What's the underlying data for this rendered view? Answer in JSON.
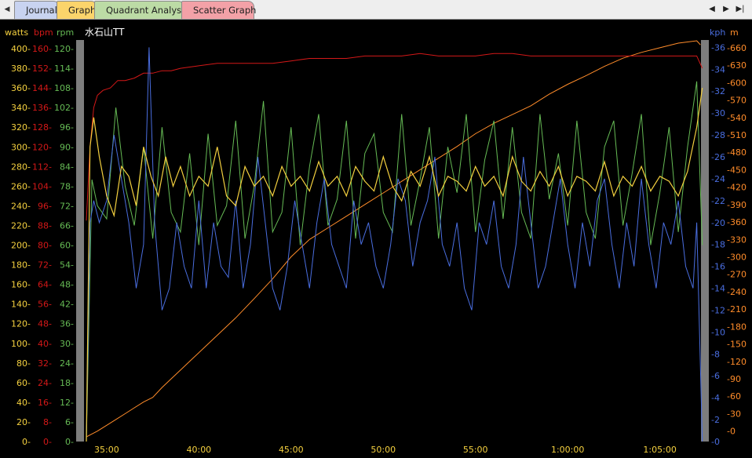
{
  "tabs": [
    {
      "label": "Journal",
      "color": "#c8d3f0"
    },
    {
      "label": "Graph",
      "color": "#fbd46b"
    },
    {
      "label": "Quadrant Analysis",
      "color": "#bcdba5"
    },
    {
      "label": "Scatter Graph",
      "color": "#f3a1a7"
    }
  ],
  "nav": {
    "left": "◀",
    "prev": "◀",
    "play": "▶",
    "next": "▶|"
  },
  "chart_data": {
    "type": "line",
    "title": "水石山TT",
    "colors": {
      "watts": "#f4d03f",
      "bpm": "#d41818",
      "rpm": "#66bb55",
      "kph": "#4a6ee0",
      "m": "#ff8c2a"
    },
    "axes": {
      "watts": {
        "label": "watts",
        "ticks": [
          0,
          20,
          40,
          60,
          80,
          100,
          120,
          140,
          160,
          180,
          200,
          220,
          240,
          260,
          280,
          300,
          320,
          340,
          360,
          380,
          400
        ],
        "range": [
          0,
          408
        ]
      },
      "bpm": {
        "label": "bpm",
        "ticks": [
          0,
          8,
          16,
          24,
          32,
          40,
          48,
          56,
          64,
          72,
          80,
          88,
          96,
          104,
          112,
          120,
          128,
          136,
          144,
          152,
          160
        ],
        "range": [
          0,
          163.2
        ]
      },
      "rpm": {
        "label": "rpm",
        "ticks": [
          0,
          6,
          12,
          18,
          24,
          30,
          36,
          42,
          48,
          54,
          60,
          66,
          72,
          78,
          84,
          90,
          96,
          102,
          108,
          114,
          120
        ],
        "range": [
          0,
          122.4
        ]
      },
      "kph": {
        "label": "kph",
        "ticks": [
          0,
          2,
          4,
          6,
          8,
          10,
          12,
          14,
          16,
          18,
          20,
          22,
          24,
          26,
          28,
          30,
          32,
          34,
          36
        ],
        "range": [
          0,
          36.6
        ]
      },
      "m": {
        "label": "m",
        "ticks": [
          0,
          -30,
          -60,
          -90,
          -120,
          -150,
          -180,
          -210,
          -240,
          -270,
          -300,
          -330,
          -360,
          -390,
          -420,
          -450,
          -480,
          -510,
          -540,
          -570,
          -600,
          -630,
          -660
        ],
        "range": [
          -18,
          672
        ]
      }
    },
    "x_ticks": [
      {
        "label": "35:00",
        "t": 35
      },
      {
        "label": "40:00",
        "t": 40
      },
      {
        "label": "45:00",
        "t": 45
      },
      {
        "label": "50:00",
        "t": 50
      },
      {
        "label": "55:00",
        "t": 55
      },
      {
        "label": "1:00:00",
        "t": 60
      },
      {
        "label": "1:05:00",
        "t": 65
      }
    ],
    "x_range": [
      33.6,
      67.4
    ],
    "grid": false,
    "series": [
      {
        "name": "m",
        "axis": "m",
        "x": [
          33.9,
          34.5,
          35.0,
          35.5,
          36.0,
          36.5,
          37.0,
          37.5,
          38.0,
          38.5,
          39.0,
          39.5,
          40.0,
          41.0,
          42.0,
          43.0,
          44.0,
          45.0,
          46.0,
          47.0,
          48.0,
          49.0,
          50.0,
          51.0,
          52.0,
          53.0,
          54.0,
          55.0,
          56.0,
          57.0,
          58.0,
          59.0,
          60.0,
          61.0,
          62.0,
          63.0,
          64.0,
          65.0,
          66.0,
          67.0,
          67.2
        ],
        "y": [
          -10,
          0,
          10,
          20,
          30,
          40,
          50,
          58,
          75,
          90,
          105,
          120,
          135,
          165,
          195,
          228,
          262,
          300,
          330,
          350,
          370,
          390,
          410,
          430,
          450,
          470,
          490,
          512,
          530,
          545,
          560,
          580,
          597,
          612,
          628,
          642,
          652,
          660,
          668,
          672,
          665
        ]
      },
      {
        "name": "bpm",
        "axis": "bpm",
        "x": [
          33.9,
          34.1,
          34.3,
          34.5,
          34.8,
          35.2,
          35.6,
          36.0,
          36.5,
          37.0,
          37.5,
          38.0,
          38.5,
          39.0,
          40.0,
          41.0,
          42.0,
          43.0,
          44.0,
          45.0,
          46.0,
          47.0,
          48.0,
          49.0,
          50.0,
          51.0,
          52.0,
          53.0,
          54.0,
          55.0,
          56.0,
          57.0,
          58.0,
          59.0,
          60.0,
          61.0,
          62.0,
          63.0,
          64.0,
          65.0,
          66.0,
          67.0,
          67.3
        ],
        "y": [
          90,
          120,
          136,
          141,
          143,
          144,
          147,
          147,
          148,
          150,
          150,
          151,
          151,
          152,
          153,
          154,
          154,
          154,
          154,
          155,
          156,
          156,
          156,
          157,
          157,
          157,
          158,
          157,
          157,
          157,
          158,
          158,
          157,
          157,
          157,
          157,
          157,
          157,
          157,
          157,
          157,
          157,
          152
        ]
      },
      {
        "name": "watts",
        "axis": "watts",
        "x": [
          33.9,
          34.1,
          34.3,
          34.6,
          35.0,
          35.4,
          35.8,
          36.2,
          36.6,
          37.0,
          37.4,
          37.8,
          38.2,
          38.6,
          39.0,
          39.5,
          40.0,
          40.5,
          41.0,
          41.5,
          42.0,
          42.5,
          43.0,
          43.5,
          44.0,
          44.5,
          45.0,
          45.5,
          46.0,
          46.5,
          47.0,
          47.5,
          48.0,
          48.5,
          49.0,
          49.5,
          50.0,
          50.5,
          51.0,
          51.5,
          52.0,
          52.5,
          53.0,
          53.5,
          54.0,
          54.5,
          55.0,
          55.5,
          56.0,
          56.5,
          57.0,
          57.5,
          58.0,
          58.5,
          59.0,
          59.5,
          60.0,
          60.5,
          61.0,
          61.5,
          62.0,
          62.5,
          63.0,
          63.5,
          64.0,
          64.5,
          65.0,
          65.5,
          66.0,
          66.5,
          67.0,
          67.3
        ],
        "y": [
          0,
          300,
          330,
          290,
          250,
          230,
          280,
          270,
          240,
          300,
          270,
          250,
          290,
          260,
          280,
          250,
          270,
          260,
          300,
          250,
          240,
          280,
          260,
          270,
          250,
          280,
          260,
          270,
          255,
          285,
          260,
          270,
          250,
          280,
          265,
          255,
          290,
          260,
          245,
          275,
          260,
          290,
          250,
          270,
          265,
          255,
          280,
          260,
          270,
          250,
          290,
          265,
          255,
          275,
          260,
          280,
          250,
          270,
          265,
          255,
          285,
          250,
          270,
          260,
          280,
          255,
          270,
          265,
          250,
          275,
          320,
          360
        ]
      },
      {
        "name": "rpm",
        "axis": "rpm",
        "x": [
          33.9,
          34.2,
          34.5,
          35.0,
          35.5,
          36.0,
          36.5,
          37.0,
          37.5,
          38.0,
          38.5,
          39.0,
          39.5,
          40.0,
          40.5,
          41.0,
          41.5,
          42.0,
          42.5,
          43.0,
          43.5,
          44.0,
          44.5,
          45.0,
          45.5,
          46.0,
          46.5,
          47.0,
          47.5,
          48.0,
          48.5,
          49.0,
          49.5,
          50.0,
          50.5,
          51.0,
          51.5,
          52.0,
          52.5,
          53.0,
          53.5,
          54.0,
          54.5,
          55.0,
          55.5,
          56.0,
          56.5,
          57.0,
          57.5,
          58.0,
          58.5,
          59.0,
          59.5,
          60.0,
          60.5,
          61.0,
          61.5,
          62.0,
          62.5,
          63.0,
          63.5,
          64.0,
          64.5,
          65.0,
          65.5,
          66.0,
          66.5,
          67.0,
          67.3
        ],
        "y": [
          0,
          80,
          72,
          68,
          102,
          78,
          66,
          90,
          62,
          96,
          70,
          64,
          88,
          60,
          94,
          66,
          72,
          98,
          62,
          78,
          104,
          64,
          70,
          96,
          60,
          84,
          100,
          66,
          74,
          98,
          62,
          88,
          94,
          70,
          64,
          100,
          66,
          80,
          96,
          62,
          90,
          76,
          100,
          64,
          86,
          98,
          68,
          96,
          70,
          62,
          100,
          74,
          88,
          66,
          98,
          70,
          62,
          90,
          98,
          66,
          82,
          100,
          60,
          76,
          96,
          64,
          90,
          110,
          60
        ]
      },
      {
        "name": "kph",
        "axis": "kph",
        "x": [
          33.9,
          34.1,
          34.3,
          34.6,
          35.0,
          35.4,
          35.8,
          36.2,
          36.6,
          37.0,
          37.3,
          37.6,
          38.0,
          38.4,
          38.8,
          39.2,
          39.6,
          40.0,
          40.4,
          40.8,
          41.2,
          41.6,
          42.0,
          42.4,
          42.8,
          43.2,
          43.6,
          44.0,
          44.4,
          44.8,
          45.2,
          45.6,
          46.0,
          46.4,
          46.8,
          47.2,
          47.6,
          48.0,
          48.4,
          48.8,
          49.2,
          49.6,
          50.0,
          50.4,
          50.8,
          51.2,
          51.6,
          52.0,
          52.4,
          52.8,
          53.2,
          53.6,
          54.0,
          54.4,
          54.8,
          55.2,
          55.6,
          56.0,
          56.4,
          56.8,
          57.2,
          57.6,
          58.0,
          58.4,
          58.8,
          59.2,
          59.6,
          60.0,
          60.4,
          60.8,
          61.2,
          61.6,
          62.0,
          62.4,
          62.8,
          63.2,
          63.6,
          64.0,
          64.4,
          64.8,
          65.2,
          65.6,
          66.0,
          66.4,
          66.8,
          67.0,
          67.3
        ],
        "y": [
          0,
          20,
          22,
          20,
          22,
          28,
          24,
          20,
          14,
          18,
          36,
          20,
          12,
          14,
          20,
          16,
          14,
          22,
          14,
          20,
          16,
          15,
          22,
          14,
          18,
          26,
          20,
          14,
          12,
          16,
          22,
          18,
          14,
          20,
          24,
          18,
          16,
          14,
          22,
          18,
          20,
          16,
          14,
          18,
          24,
          22,
          16,
          20,
          22,
          26,
          18,
          16,
          20,
          14,
          12,
          20,
          18,
          22,
          16,
          14,
          18,
          26,
          20,
          14,
          16,
          20,
          24,
          18,
          14,
          20,
          16,
          22,
          24,
          18,
          14,
          20,
          16,
          24,
          18,
          14,
          20,
          18,
          22,
          16,
          14,
          20,
          0
        ]
      }
    ]
  }
}
